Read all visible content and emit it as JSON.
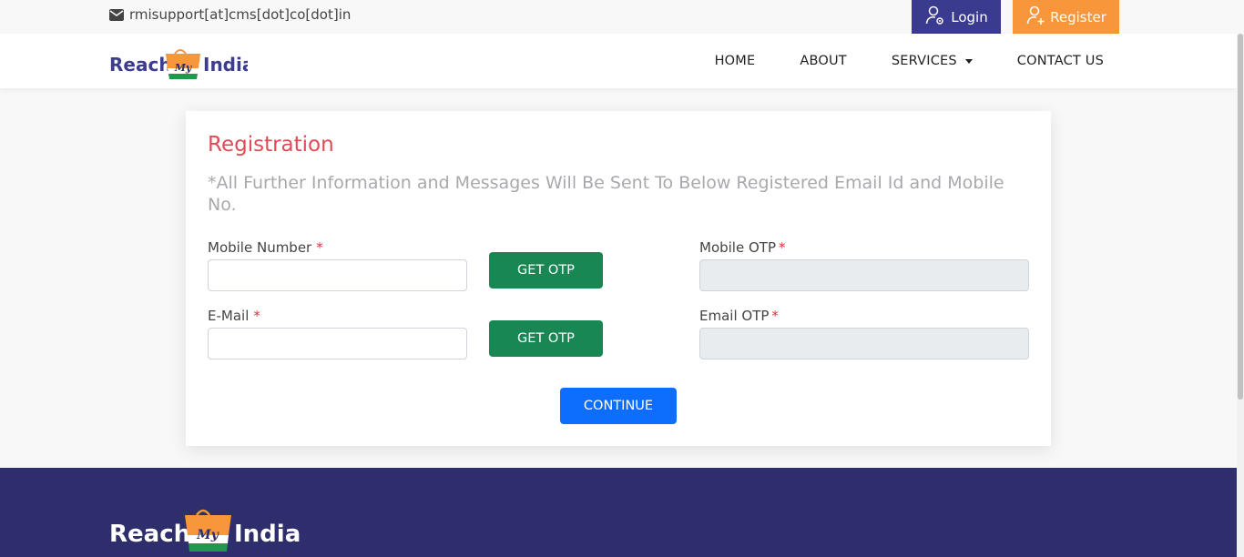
{
  "topbar": {
    "email_text": "rmisupport[at]cms[dot]co[dot]in",
    "login_label": "Login",
    "register_label": "Register"
  },
  "logo": {
    "word_left": "Reach",
    "word_middle": "My",
    "word_right": "India"
  },
  "nav": {
    "home": "HOME",
    "about": "ABOUT",
    "services": "SERVICES",
    "contact": "CONTACT US"
  },
  "form": {
    "title": "Registration",
    "note": "*All Further Information and Messages Will Be Sent To Below Registered Email Id and Mobile No.",
    "mobile_label": "Mobile Number",
    "mobile_value": "",
    "email_label": "E-Mail",
    "email_value": "",
    "mobile_otp_label": "Mobile OTP",
    "email_otp_label": "Email OTP",
    "required_mark": "*",
    "get_otp_label": "GET OTP",
    "continue_label": "CONTINUE"
  },
  "colors": {
    "brand_navy": "#2e2e6c",
    "login_bg": "#3a3a8e",
    "register_bg": "#f7963a",
    "title_red": "#e04a55",
    "otp_green": "#198754",
    "continue_blue": "#0d6efd"
  },
  "icons": [
    "envelope-icon",
    "login-user-icon",
    "register-user-icon",
    "dropdown-caret-icon"
  ]
}
